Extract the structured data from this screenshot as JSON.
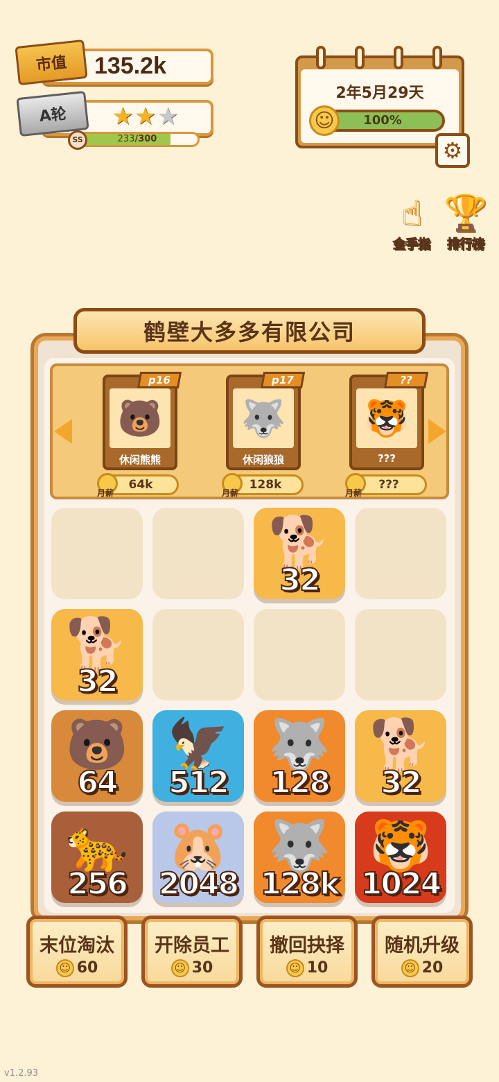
{
  "stats": {
    "market_value_label": "市值",
    "market_value": "135.2k",
    "round_label": "A轮",
    "stars_total": 3,
    "stars_filled": 2,
    "rank_label": "SS",
    "xp_current": "233",
    "xp_total": "/300",
    "xp_fraction": 0.777
  },
  "calendar": {
    "date": "2年5月29天",
    "mood_percent": "100%",
    "mood_fraction": 1.0
  },
  "side_buttons": {
    "golden_finger_label": "金手指",
    "leaderboard_label": "排行榜"
  },
  "company": {
    "name": "鹤壁大多多有限公司"
  },
  "upcoming": [
    {
      "name": "休闲熊熊",
      "level": "p16",
      "salary_label": "月薪",
      "salary": "64k",
      "icon": "bear"
    },
    {
      "name": "休闲狼狼",
      "level": "p17",
      "salary_label": "月薪",
      "salary": "128k",
      "icon": "wolf"
    },
    {
      "name": "???",
      "level": "??",
      "salary_label": "月薪",
      "salary": "???",
      "icon": "tiger-silhouette"
    }
  ],
  "grid": [
    [
      {
        "value": ""
      },
      {
        "value": ""
      },
      {
        "value": "32",
        "animal": "shiba",
        "color": "#f6b94a"
      },
      {
        "value": ""
      }
    ],
    [
      {
        "value": "32",
        "animal": "shiba",
        "color": "#f6b94a"
      },
      {
        "value": ""
      },
      {
        "value": ""
      },
      {
        "value": ""
      }
    ],
    [
      {
        "value": "64",
        "animal": "bear",
        "color": "#d88a3a"
      },
      {
        "value": "512",
        "animal": "eagle",
        "color": "#3fb0e0"
      },
      {
        "value": "128",
        "animal": "wolf",
        "color": "#f08a2c"
      },
      {
        "value": "32",
        "animal": "shiba",
        "color": "#f6b94a"
      }
    ],
    [
      {
        "value": "256",
        "animal": "leopard",
        "color": "#a9603a"
      },
      {
        "value": "2048",
        "animal": "hamster",
        "color": "#b9c8e8"
      },
      {
        "value": "128k",
        "animal": "wolf",
        "color": "#f08a2c"
      },
      {
        "value": "1024",
        "animal": "tiger",
        "color": "#d83a1c"
      }
    ]
  ],
  "actions": [
    {
      "label": "末位淘汰",
      "cost": "60"
    },
    {
      "label": "开除员工",
      "cost": "30"
    },
    {
      "label": "撤回抉择",
      "cost": "10"
    },
    {
      "label": "随机升级",
      "cost": "20"
    }
  ],
  "version": "v1.2.93"
}
